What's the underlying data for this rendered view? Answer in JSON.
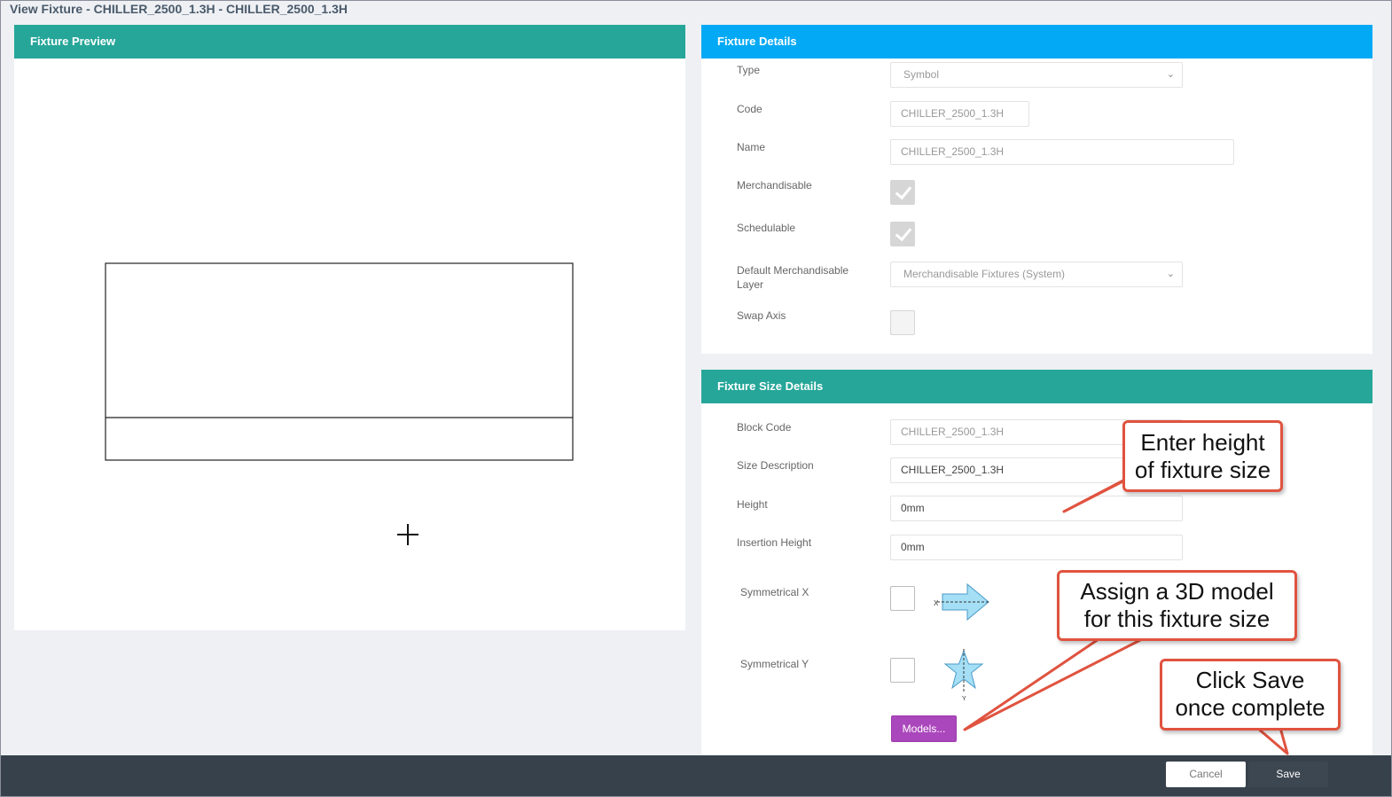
{
  "page": {
    "title": "View Fixture - CHILLER_2500_1.3H - CHILLER_2500_1.3H"
  },
  "preview": {
    "header": "Fixture Preview"
  },
  "details": {
    "header": "Fixture Details",
    "type_label": "Type",
    "type_value": "Symbol",
    "code_label": "Code",
    "code_value": "CHILLER_2500_1.3H",
    "name_label": "Name",
    "name_value": "CHILLER_2500_1.3H",
    "merchandisable_label": "Merchandisable",
    "merchandisable_checked": true,
    "schedulable_label": "Schedulable",
    "schedulable_checked": true,
    "layer_label_line1": "Default Merchandisable",
    "layer_label_line2": "Layer",
    "layer_value": "Merchandisable Fixtures (System)",
    "swap_axis_label": "Swap Axis",
    "swap_axis_checked": false
  },
  "size_details": {
    "header": "Fixture Size Details",
    "block_code_label": "Block Code",
    "block_code_value": "CHILLER_2500_1.3H",
    "size_desc_label": "Size Description",
    "size_desc_value": "CHILLER_2500_1.3H",
    "height_label": "Height",
    "height_value": "0mm",
    "insertion_height_label": "Insertion Height",
    "insertion_height_value": "0mm",
    "sym_x_label": "Symmetrical X",
    "sym_x_axis_letter": "X",
    "sym_y_label": "Symmetrical Y",
    "sym_y_axis_letter": "Y",
    "models_label": "Models..."
  },
  "footer": {
    "cancel_label": "Cancel",
    "save_label": "Save"
  },
  "callouts": {
    "height": [
      "Enter height",
      "of fixture size"
    ],
    "models": [
      "Assign a 3D model",
      "for this fixture size"
    ],
    "save": [
      "Click Save",
      "once complete"
    ]
  },
  "colors": {
    "teal_header": "#26a699",
    "blue_header": "#03a9f4",
    "models_button": "#ab47bc",
    "footer": "#37414b",
    "callout_border": "#e0533f"
  }
}
